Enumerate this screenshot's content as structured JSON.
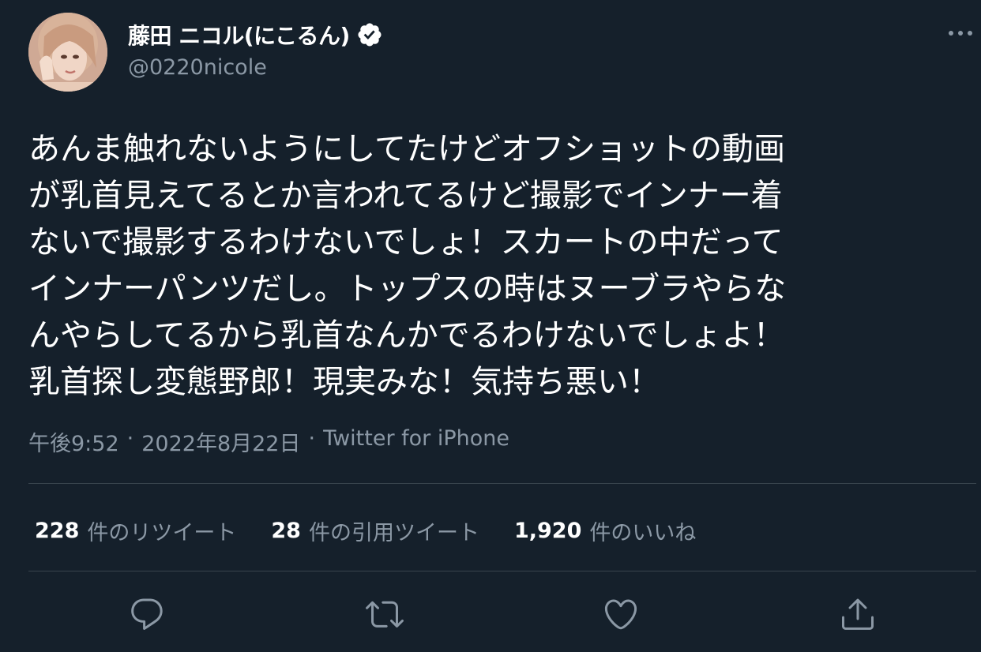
{
  "user": {
    "display_name": "藤田 ニコル(にこるん)",
    "handle": "@0220nicole",
    "verified": true
  },
  "tweet": {
    "text": "あんま触れないようにしてたけどオフショットの動画\nが乳首見えてるとか言われてるけど撮影でインナー着\nないで撮影するわけないでしょ！スカートの中だって\nインナーパンツだし。トップスの時はヌーブラやらな\nんやらしてるから乳首なんかでるわけないでしょよ！\n乳首探し変態野郎！現実みな！気持ち悪い！",
    "time": "午後9:52",
    "date": "2022年8月22日",
    "separator": "·",
    "source": "Twitter for iPhone"
  },
  "stats": {
    "retweets": {
      "count": "228",
      "label": "件のリツイート"
    },
    "quotes": {
      "count": "28",
      "label": "件の引用ツイート"
    },
    "likes": {
      "count": "1,920",
      "label": "件のいいね"
    }
  },
  "icons": {
    "more": "more-icon",
    "reply": "reply-icon",
    "retweet": "retweet-icon",
    "like": "heart-icon",
    "share": "share-icon",
    "verified": "verified-badge-icon"
  },
  "colors": {
    "background": "#15202b",
    "text": "#ffffff",
    "secondary": "#8b98a5",
    "divider": "#38444d"
  }
}
